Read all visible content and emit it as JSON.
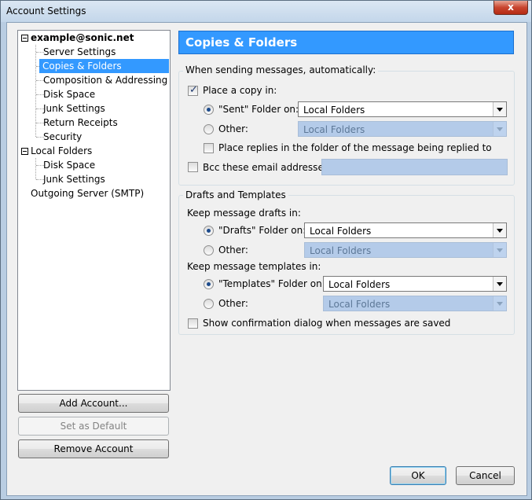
{
  "window": {
    "title": "Account Settings",
    "close_glyph": "x"
  },
  "tree": {
    "account": "example@sonic.net",
    "account_children": [
      "Server Settings",
      "Copies & Folders",
      "Composition & Addressing",
      "Disk Space",
      "Junk Settings",
      "Return Receipts",
      "Security"
    ],
    "local": "Local Folders",
    "local_children": [
      "Disk Space",
      "Junk Settings"
    ],
    "smtp": "Outgoing Server (SMTP)",
    "selected": "Copies & Folders"
  },
  "left_buttons": {
    "add": "Add Account...",
    "default": "Set as Default",
    "remove": "Remove Account"
  },
  "header": {
    "title": "Copies & Folders"
  },
  "sending": {
    "group_title": "When sending messages, automatically:",
    "place_copy": {
      "label": "Place a copy in:",
      "checked": true
    },
    "sent_folder": {
      "label": "\"Sent\" Folder on:",
      "value": "Local Folders",
      "selected": true
    },
    "other": {
      "label": "Other:",
      "value": "Local Folders"
    },
    "place_replies": {
      "label": "Place replies in the folder of the message being replied to",
      "checked": false
    },
    "bcc": {
      "label": "Bcc these email addresses:",
      "checked": false,
      "value": ""
    }
  },
  "drafts": {
    "group_title": "Drafts and Templates",
    "drafts_heading": "Keep message drafts in:",
    "drafts_folder": {
      "label": "\"Drafts\" Folder on:",
      "value": "Local Folders"
    },
    "drafts_other": {
      "label": "Other:",
      "value": "Local Folders"
    },
    "templates_heading": "Keep message templates in:",
    "templates_folder": {
      "label": "\"Templates\" Folder on:",
      "value": "Local Folders"
    },
    "templates_other": {
      "label": "Other:",
      "value": "Local Folders"
    },
    "show_confirm": {
      "label": "Show confirmation dialog when messages are saved",
      "checked": false
    }
  },
  "footer": {
    "ok": "OK",
    "cancel": "Cancel"
  },
  "colors": {
    "accent": "#3399ff",
    "disabled_field": "#b4cbe9",
    "close_button": "#c8452f"
  }
}
